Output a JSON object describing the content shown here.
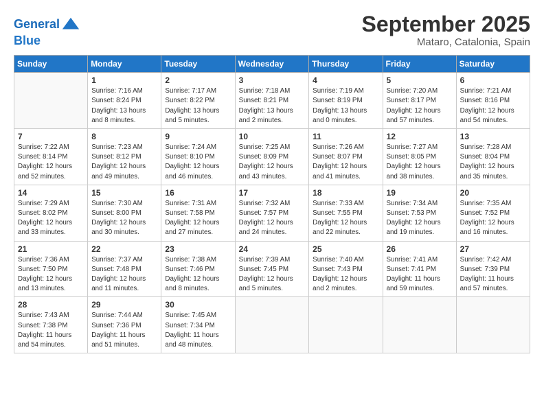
{
  "logo": {
    "line1": "General",
    "line2": "Blue"
  },
  "title": "September 2025",
  "location": "Mataro, Catalonia, Spain",
  "weekdays": [
    "Sunday",
    "Monday",
    "Tuesday",
    "Wednesday",
    "Thursday",
    "Friday",
    "Saturday"
  ],
  "weeks": [
    [
      {
        "day": "",
        "sunrise": "",
        "sunset": "",
        "daylight": ""
      },
      {
        "day": "1",
        "sunrise": "Sunrise: 7:16 AM",
        "sunset": "Sunset: 8:24 PM",
        "daylight": "Daylight: 13 hours and 8 minutes."
      },
      {
        "day": "2",
        "sunrise": "Sunrise: 7:17 AM",
        "sunset": "Sunset: 8:22 PM",
        "daylight": "Daylight: 13 hours and 5 minutes."
      },
      {
        "day": "3",
        "sunrise": "Sunrise: 7:18 AM",
        "sunset": "Sunset: 8:21 PM",
        "daylight": "Daylight: 13 hours and 2 minutes."
      },
      {
        "day": "4",
        "sunrise": "Sunrise: 7:19 AM",
        "sunset": "Sunset: 8:19 PM",
        "daylight": "Daylight: 13 hours and 0 minutes."
      },
      {
        "day": "5",
        "sunrise": "Sunrise: 7:20 AM",
        "sunset": "Sunset: 8:17 PM",
        "daylight": "Daylight: 12 hours and 57 minutes."
      },
      {
        "day": "6",
        "sunrise": "Sunrise: 7:21 AM",
        "sunset": "Sunset: 8:16 PM",
        "daylight": "Daylight: 12 hours and 54 minutes."
      }
    ],
    [
      {
        "day": "7",
        "sunrise": "Sunrise: 7:22 AM",
        "sunset": "Sunset: 8:14 PM",
        "daylight": "Daylight: 12 hours and 52 minutes."
      },
      {
        "day": "8",
        "sunrise": "Sunrise: 7:23 AM",
        "sunset": "Sunset: 8:12 PM",
        "daylight": "Daylight: 12 hours and 49 minutes."
      },
      {
        "day": "9",
        "sunrise": "Sunrise: 7:24 AM",
        "sunset": "Sunset: 8:10 PM",
        "daylight": "Daylight: 12 hours and 46 minutes."
      },
      {
        "day": "10",
        "sunrise": "Sunrise: 7:25 AM",
        "sunset": "Sunset: 8:09 PM",
        "daylight": "Daylight: 12 hours and 43 minutes."
      },
      {
        "day": "11",
        "sunrise": "Sunrise: 7:26 AM",
        "sunset": "Sunset: 8:07 PM",
        "daylight": "Daylight: 12 hours and 41 minutes."
      },
      {
        "day": "12",
        "sunrise": "Sunrise: 7:27 AM",
        "sunset": "Sunset: 8:05 PM",
        "daylight": "Daylight: 12 hours and 38 minutes."
      },
      {
        "day": "13",
        "sunrise": "Sunrise: 7:28 AM",
        "sunset": "Sunset: 8:04 PM",
        "daylight": "Daylight: 12 hours and 35 minutes."
      }
    ],
    [
      {
        "day": "14",
        "sunrise": "Sunrise: 7:29 AM",
        "sunset": "Sunset: 8:02 PM",
        "daylight": "Daylight: 12 hours and 33 minutes."
      },
      {
        "day": "15",
        "sunrise": "Sunrise: 7:30 AM",
        "sunset": "Sunset: 8:00 PM",
        "daylight": "Daylight: 12 hours and 30 minutes."
      },
      {
        "day": "16",
        "sunrise": "Sunrise: 7:31 AM",
        "sunset": "Sunset: 7:58 PM",
        "daylight": "Daylight: 12 hours and 27 minutes."
      },
      {
        "day": "17",
        "sunrise": "Sunrise: 7:32 AM",
        "sunset": "Sunset: 7:57 PM",
        "daylight": "Daylight: 12 hours and 24 minutes."
      },
      {
        "day": "18",
        "sunrise": "Sunrise: 7:33 AM",
        "sunset": "Sunset: 7:55 PM",
        "daylight": "Daylight: 12 hours and 22 minutes."
      },
      {
        "day": "19",
        "sunrise": "Sunrise: 7:34 AM",
        "sunset": "Sunset: 7:53 PM",
        "daylight": "Daylight: 12 hours and 19 minutes."
      },
      {
        "day": "20",
        "sunrise": "Sunrise: 7:35 AM",
        "sunset": "Sunset: 7:52 PM",
        "daylight": "Daylight: 12 hours and 16 minutes."
      }
    ],
    [
      {
        "day": "21",
        "sunrise": "Sunrise: 7:36 AM",
        "sunset": "Sunset: 7:50 PM",
        "daylight": "Daylight: 12 hours and 13 minutes."
      },
      {
        "day": "22",
        "sunrise": "Sunrise: 7:37 AM",
        "sunset": "Sunset: 7:48 PM",
        "daylight": "Daylight: 12 hours and 11 minutes."
      },
      {
        "day": "23",
        "sunrise": "Sunrise: 7:38 AM",
        "sunset": "Sunset: 7:46 PM",
        "daylight": "Daylight: 12 hours and 8 minutes."
      },
      {
        "day": "24",
        "sunrise": "Sunrise: 7:39 AM",
        "sunset": "Sunset: 7:45 PM",
        "daylight": "Daylight: 12 hours and 5 minutes."
      },
      {
        "day": "25",
        "sunrise": "Sunrise: 7:40 AM",
        "sunset": "Sunset: 7:43 PM",
        "daylight": "Daylight: 12 hours and 2 minutes."
      },
      {
        "day": "26",
        "sunrise": "Sunrise: 7:41 AM",
        "sunset": "Sunset: 7:41 PM",
        "daylight": "Daylight: 11 hours and 59 minutes."
      },
      {
        "day": "27",
        "sunrise": "Sunrise: 7:42 AM",
        "sunset": "Sunset: 7:39 PM",
        "daylight": "Daylight: 11 hours and 57 minutes."
      }
    ],
    [
      {
        "day": "28",
        "sunrise": "Sunrise: 7:43 AM",
        "sunset": "Sunset: 7:38 PM",
        "daylight": "Daylight: 11 hours and 54 minutes."
      },
      {
        "day": "29",
        "sunrise": "Sunrise: 7:44 AM",
        "sunset": "Sunset: 7:36 PM",
        "daylight": "Daylight: 11 hours and 51 minutes."
      },
      {
        "day": "30",
        "sunrise": "Sunrise: 7:45 AM",
        "sunset": "Sunset: 7:34 PM",
        "daylight": "Daylight: 11 hours and 48 minutes."
      },
      {
        "day": "",
        "sunrise": "",
        "sunset": "",
        "daylight": ""
      },
      {
        "day": "",
        "sunrise": "",
        "sunset": "",
        "daylight": ""
      },
      {
        "day": "",
        "sunrise": "",
        "sunset": "",
        "daylight": ""
      },
      {
        "day": "",
        "sunrise": "",
        "sunset": "",
        "daylight": ""
      }
    ]
  ]
}
